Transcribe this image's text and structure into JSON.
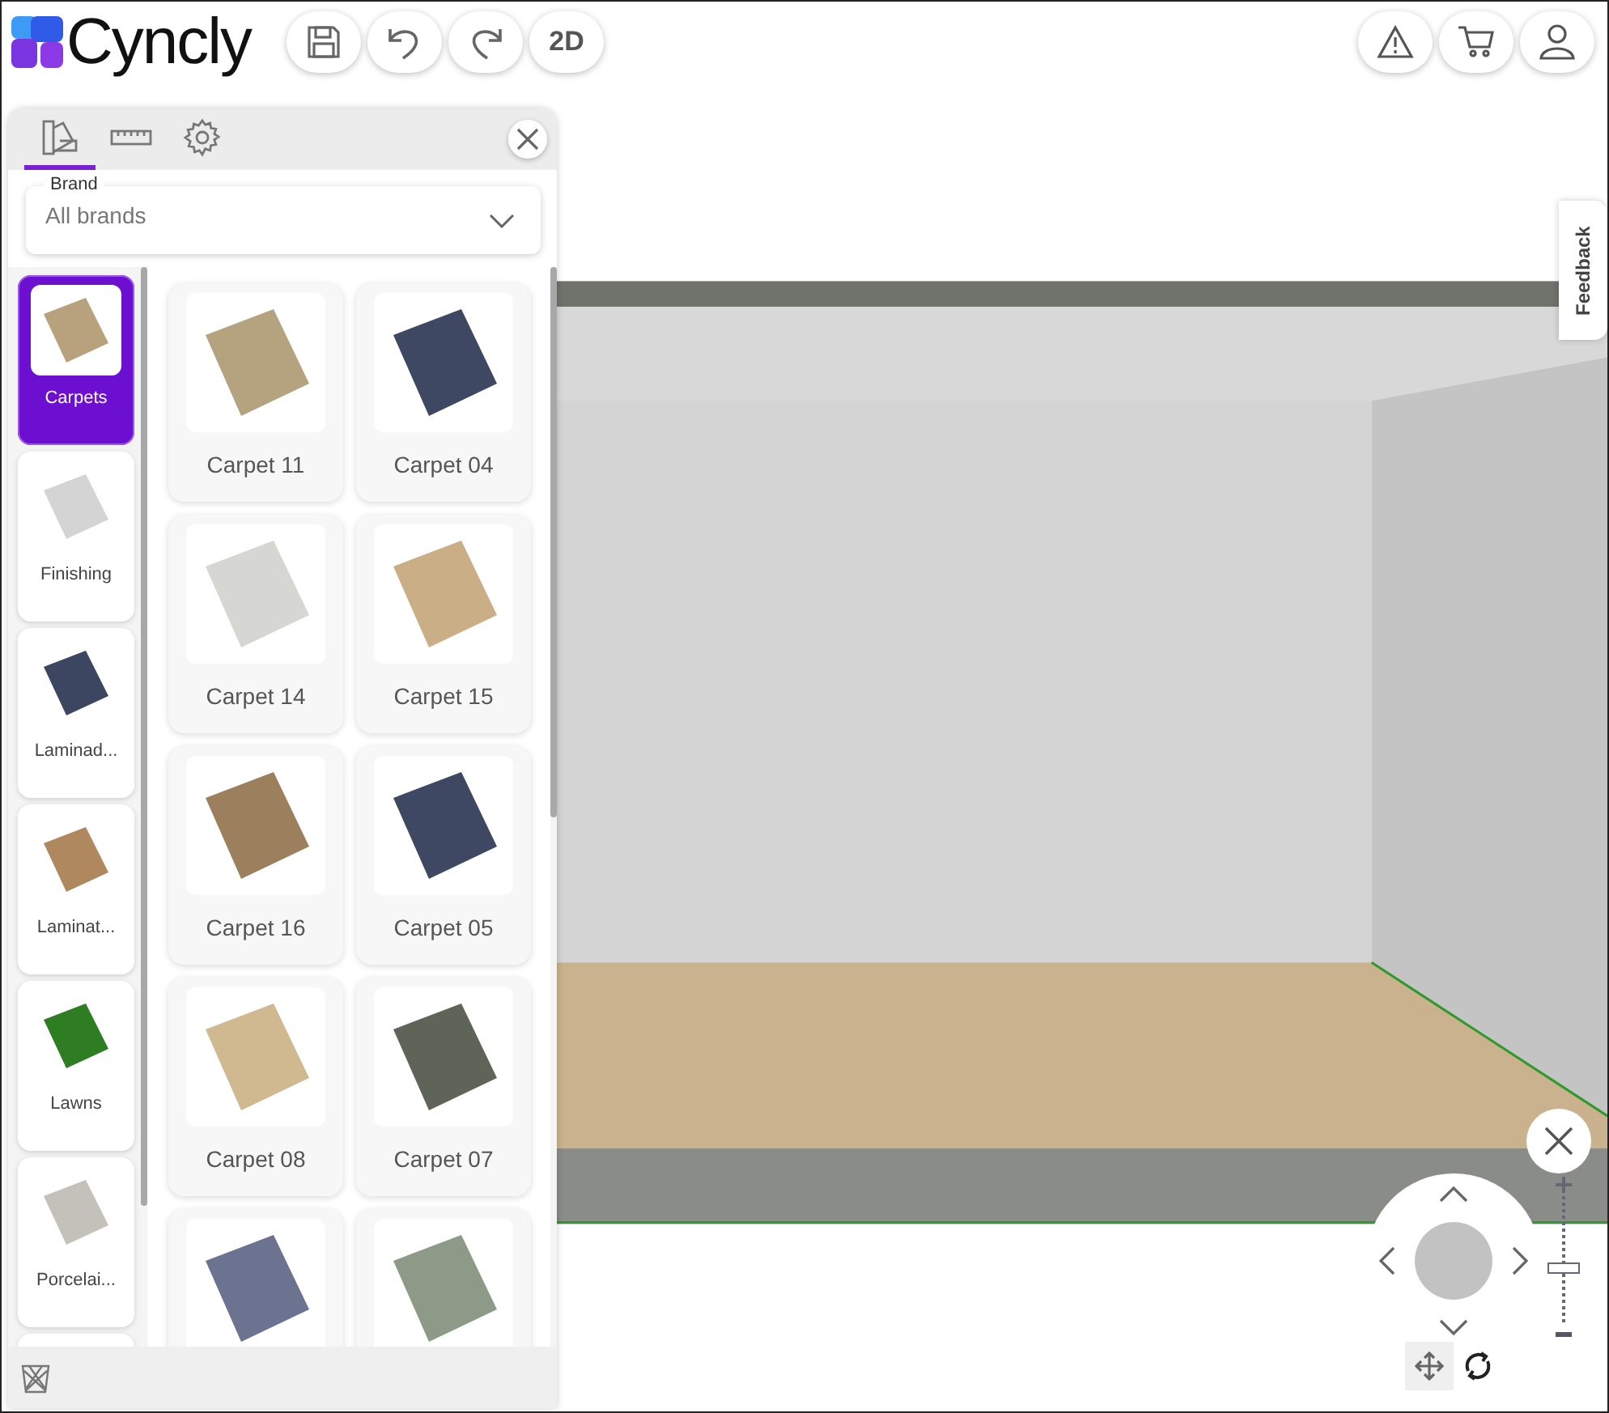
{
  "header": {
    "logo": "Cyncly",
    "tools": [
      {
        "kind": "save"
      },
      {
        "kind": "undo"
      },
      {
        "kind": "redo"
      },
      {
        "kind": "text",
        "label": "2D"
      }
    ],
    "actions": [
      {
        "kind": "warning"
      },
      {
        "kind": "cart"
      },
      {
        "kind": "user"
      }
    ]
  },
  "panel": {
    "tabs": [
      {
        "kind": "swatches",
        "selected": true
      },
      {
        "kind": "ruler",
        "selected": false
      },
      {
        "kind": "settings",
        "selected": false
      }
    ],
    "brand": {
      "label": "Brand",
      "value": "All brands"
    },
    "categories": [
      {
        "label": "Carpets",
        "selected": true,
        "color": "#b8a27e"
      },
      {
        "label": "Finishing",
        "selected": false,
        "color": "#d4d4d4"
      },
      {
        "label": "Laminad...",
        "selected": false,
        "color": "#3c4660"
      },
      {
        "label": "Laminat...",
        "selected": false,
        "color": "#b08860"
      },
      {
        "label": "Lawns",
        "selected": false,
        "color": "#2e7d22"
      },
      {
        "label": "Porcelai...",
        "selected": false,
        "color": "#c4c0ba"
      },
      {
        "selected": false
      }
    ],
    "products": [
      {
        "name": "Carpet 11",
        "color": "#b5a27e"
      },
      {
        "name": "Carpet 04",
        "color": "#3e4862"
      },
      {
        "name": "Carpet 14",
        "color": "#d6d6d2"
      },
      {
        "name": "Carpet 15",
        "color": "#c9ae86"
      },
      {
        "name": "Carpet 16",
        "color": "#9c7f5c"
      },
      {
        "name": "Carpet 05",
        "color": "#3e4862"
      },
      {
        "name": "Carpet 08",
        "color": "#d0b890"
      },
      {
        "name": "Carpet 07",
        "color": "#5e6458"
      },
      {
        "color": "#6b7390"
      },
      {
        "color": "#8e9a88"
      }
    ]
  },
  "feedback": "Feedback",
  "zoom": {
    "level": 0.45
  }
}
